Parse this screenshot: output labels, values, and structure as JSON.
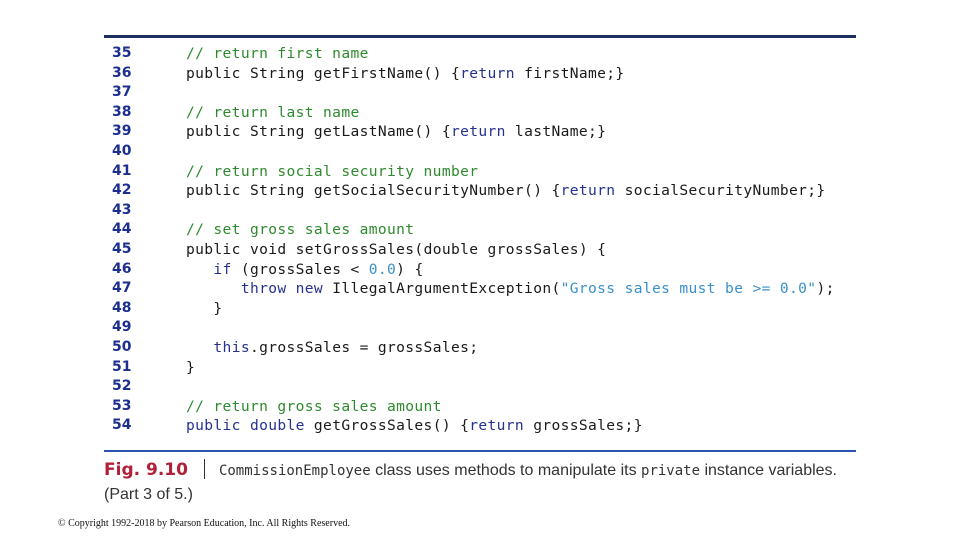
{
  "listing": {
    "lines": [
      {
        "num": "35",
        "tokens": [
          {
            "t": "// return first name",
            "c": "comment"
          }
        ]
      },
      {
        "num": "36",
        "tokens": [
          {
            "t": "public ",
            "c": "type"
          },
          {
            "t": "String getFirstName() {",
            "c": "plain"
          },
          {
            "t": "return",
            "c": "keyword"
          },
          {
            "t": " firstName;}",
            "c": "plain"
          }
        ]
      },
      {
        "num": "37",
        "tokens": []
      },
      {
        "num": "38",
        "tokens": [
          {
            "t": "// return last name",
            "c": "comment"
          }
        ]
      },
      {
        "num": "39",
        "tokens": [
          {
            "t": "public ",
            "c": "type"
          },
          {
            "t": "String getLastName() {",
            "c": "plain"
          },
          {
            "t": "return",
            "c": "keyword"
          },
          {
            "t": " lastName;}",
            "c": "plain"
          }
        ]
      },
      {
        "num": "40",
        "tokens": []
      },
      {
        "num": "41",
        "tokens": [
          {
            "t": "// return social security number",
            "c": "comment"
          }
        ]
      },
      {
        "num": "42",
        "tokens": [
          {
            "t": "public ",
            "c": "type"
          },
          {
            "t": "String getSocialSecurityNumber() {",
            "c": "plain"
          },
          {
            "t": "return",
            "c": "keyword"
          },
          {
            "t": " socialSecurityNumber;}",
            "c": "plain"
          }
        ]
      },
      {
        "num": "43",
        "tokens": []
      },
      {
        "num": "44",
        "tokens": [
          {
            "t": "// set gross sales amount",
            "c": "comment"
          }
        ]
      },
      {
        "num": "45",
        "tokens": [
          {
            "t": "public void ",
            "c": "type"
          },
          {
            "t": "setGrossSales(",
            "c": "plain"
          },
          {
            "t": "double",
            "c": "type"
          },
          {
            "t": " grossSales) {",
            "c": "plain"
          }
        ]
      },
      {
        "num": "46",
        "tokens": [
          {
            "t": "   ",
            "c": "plain"
          },
          {
            "t": "if",
            "c": "keyword"
          },
          {
            "t": " (grossSales < ",
            "c": "plain"
          },
          {
            "t": "0.0",
            "c": "number"
          },
          {
            "t": ") {",
            "c": "plain"
          }
        ]
      },
      {
        "num": "47",
        "tokens": [
          {
            "t": "      ",
            "c": "plain"
          },
          {
            "t": "throw new",
            "c": "keyword"
          },
          {
            "t": " IllegalArgumentException(",
            "c": "plain"
          },
          {
            "t": "\"Gross sales must be >= 0.0\"",
            "c": "string"
          },
          {
            "t": ");",
            "c": "plain"
          }
        ]
      },
      {
        "num": "48",
        "tokens": [
          {
            "t": "   }",
            "c": "plain"
          }
        ]
      },
      {
        "num": "49",
        "tokens": []
      },
      {
        "num": "50",
        "tokens": [
          {
            "t": "   ",
            "c": "plain"
          },
          {
            "t": "this",
            "c": "keyword"
          },
          {
            "t": ".grossSales = grossSales;",
            "c": "plain"
          }
        ]
      },
      {
        "num": "51",
        "tokens": [
          {
            "t": "}",
            "c": "plain"
          }
        ]
      },
      {
        "num": "52",
        "tokens": []
      },
      {
        "num": "53",
        "tokens": [
          {
            "t": "// return gross sales amount",
            "c": "comment"
          }
        ]
      },
      {
        "num": "54",
        "tokens": [
          {
            "t": "public double",
            "c": "keyword"
          },
          {
            "t": " getGrossSales() {",
            "c": "plain"
          },
          {
            "t": "return",
            "c": "keyword"
          },
          {
            "t": " grossSales;}",
            "c": "plain"
          }
        ]
      }
    ]
  },
  "caption": {
    "fig_label": "Fig. 9.10",
    "class_name": "CommissionEmployee",
    "text_1": " class uses methods to manipulate its ",
    "keyword": "private",
    "text_2": " instance variables. (Part 3 of 5.)"
  },
  "footer": {
    "copyright": "© Copyright 1992-2018 by Pearson Education, Inc. All Rights Reserved."
  },
  "colors": {
    "line_numbers": "#1c2f8f",
    "comment": "#2f8a2f",
    "keyword": "#26328f",
    "literal": "#3a90c8",
    "fig_label": "#b0203a",
    "top_rule": "#1b2f5e",
    "bottom_rule": "#2a53b0"
  }
}
